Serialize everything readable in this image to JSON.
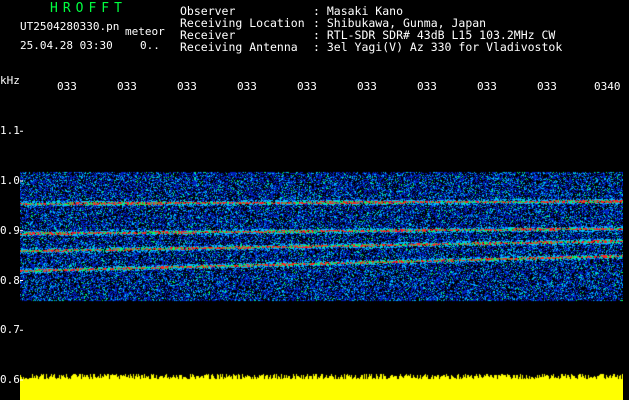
{
  "header": {
    "app_title": "HROFFT",
    "filename": "UT2504280330.pn",
    "meteor_label": "meteor",
    "datetime": "25.04.28 03:30",
    "count": "0..",
    "fields": [
      {
        "label": "Observer",
        "value": ": Masaki Kano"
      },
      {
        "label": "Receiving Location",
        "value": ": Shibukawa, Gunma, Japan"
      },
      {
        "label": "Receiver",
        "value": ": RTL-SDR SDR# 43dB L15 103.2MHz CW"
      },
      {
        "label": "Receiving Antenna",
        "value": ": 3el Yagi(V) Az 330 for Vladivostok"
      }
    ]
  },
  "axes": {
    "y_unit": "kHz",
    "y_ticks": [
      "1.1",
      "1.0",
      "0.9",
      "0.8",
      "0.7",
      "0.6"
    ],
    "x_ticks": [
      "033",
      "033",
      "033",
      "033",
      "033",
      "033",
      "033",
      "033",
      "033",
      "0340"
    ]
  },
  "colors": {
    "background": "#000000",
    "title_green": "#00ff40",
    "text_white": "#ffffff",
    "noise_bar": "#ffff00",
    "spectrum_blue": "#0020c0",
    "spectrum_cyan": "#00c0ff",
    "spectrum_green": "#00ff60",
    "signal_red": "#ff2020"
  },
  "chart_data": {
    "type": "heatmap",
    "xlabel": "",
    "ylabel": "kHz",
    "ylim": [
      0.6,
      1.2
    ],
    "x_ticks": [
      "033",
      "033",
      "033",
      "033",
      "033",
      "033",
      "033",
      "033",
      "033",
      "0340"
    ],
    "y_ticks": [
      1.1,
      1.0,
      0.9,
      0.8,
      0.7,
      0.6
    ],
    "noise_band_khz": [
      0.76,
      1.02
    ],
    "signal_lines": [
      {
        "start_khz": 0.895,
        "end_khz": 0.905
      },
      {
        "start_khz": 0.82,
        "end_khz": 0.85
      },
      {
        "start_khz": 0.955,
        "end_khz": 0.96
      },
      {
        "start_khz": 0.86,
        "end_khz": 0.88
      }
    ],
    "bottom_noise_khz": 0.595
  }
}
